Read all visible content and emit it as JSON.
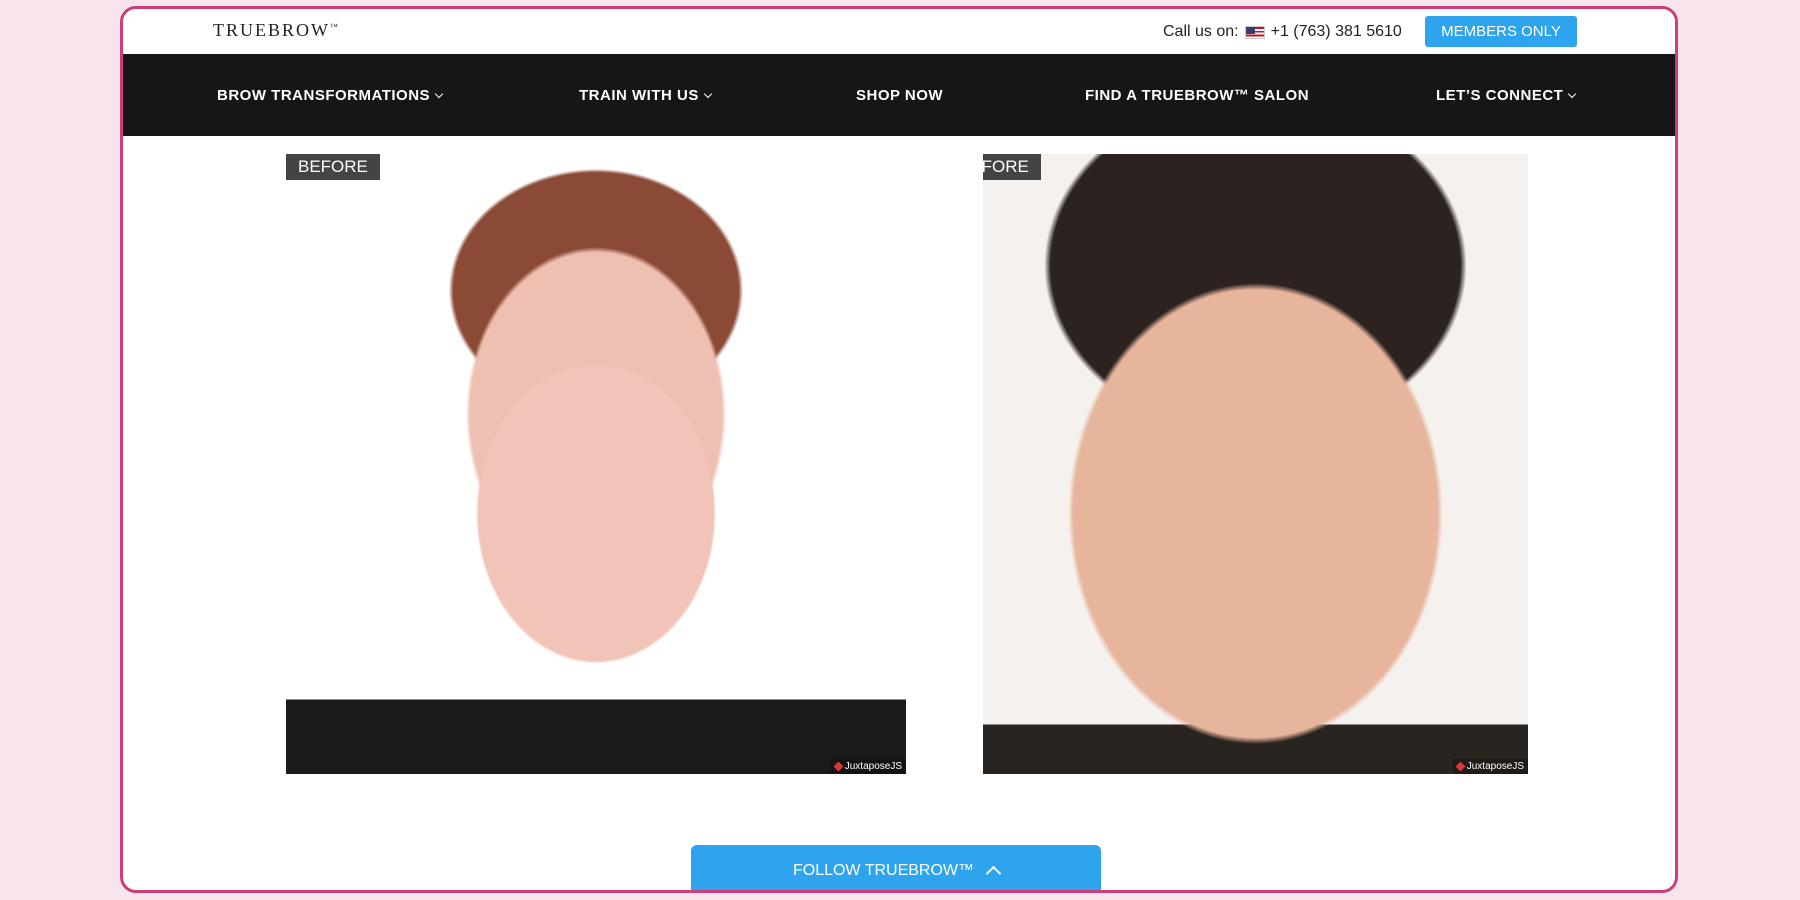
{
  "topbar": {
    "logo": "TRUEBROW",
    "logo_tm": "™",
    "call_label": "Call us on:",
    "phone": "+1 (763) 381 5610",
    "members_button": "MEMBERS ONLY"
  },
  "nav": {
    "items": [
      {
        "label": "BROW TRANSFORMATIONS",
        "dropdown": true
      },
      {
        "label": "TRAIN WITH US",
        "dropdown": true
      },
      {
        "label": "SHOP NOW",
        "dropdown": false
      },
      {
        "label": "FIND A TRUEBROW™ SALON",
        "dropdown": false
      },
      {
        "label": "LET’S CONNECT",
        "dropdown": true
      }
    ]
  },
  "gallery": {
    "images": [
      {
        "label": "BEFORE",
        "watermark": "JuxtaposeJS"
      },
      {
        "label": "BEFORE",
        "watermark": "JuxtaposeJS"
      }
    ]
  },
  "follow": {
    "label": "FOLLOW TRUEBROW™"
  },
  "colors": {
    "accent": "#2ea3ee",
    "frame_border": "#cc3d7a",
    "nav_bg": "#161616"
  }
}
